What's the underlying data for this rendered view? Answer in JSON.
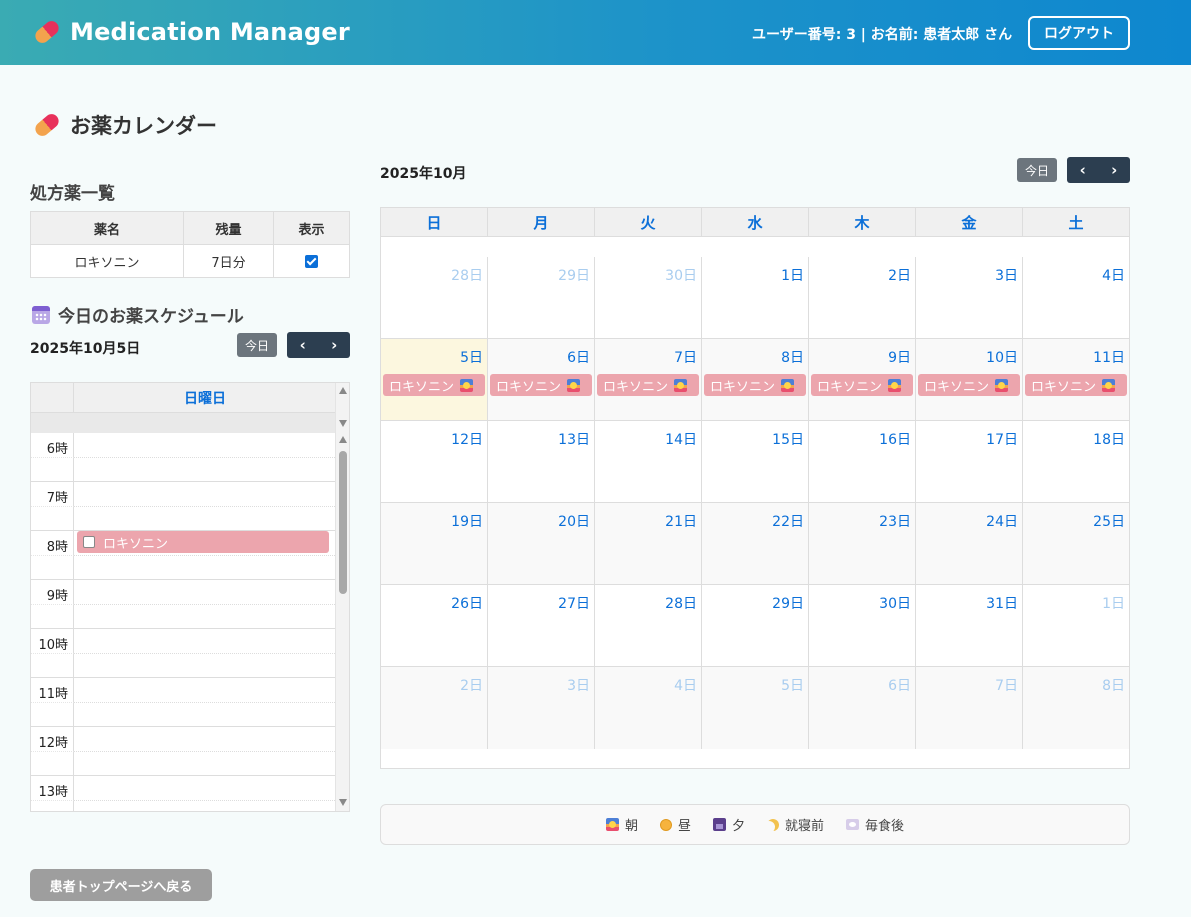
{
  "header": {
    "app_title": "Medication Manager",
    "user_info": "ユーザー番号: 3 | お名前: 患者太郎 さん",
    "logout_label": "ログアウト"
  },
  "page": {
    "title": "お薬カレンダー"
  },
  "prescriptions": {
    "heading": "処方薬一覧",
    "columns": [
      "薬名",
      "残量",
      "表示"
    ],
    "rows": [
      {
        "name": "ロキソニン",
        "remaining": "7日分",
        "shown": true
      }
    ]
  },
  "day_schedule": {
    "heading": "今日のお薬スケジュール",
    "date_label": "2025年10月5日",
    "today_label": "今日",
    "prev_icon": "chevron-left-icon",
    "next_icon": "chevron-right-icon",
    "day_of_week": "日曜日",
    "hours": [
      "6時",
      "7時",
      "8時",
      "9時",
      "10時",
      "11時",
      "12時",
      "13時"
    ],
    "event": {
      "hour": "8時",
      "label": "ロキソニン"
    }
  },
  "month_calendar": {
    "month_label": "2025年10月",
    "today_label": "今日",
    "weekdays": [
      "日",
      "月",
      "火",
      "水",
      "木",
      "金",
      "土"
    ],
    "weeks": [
      [
        {
          "d": "28日",
          "o": true
        },
        {
          "d": "29日",
          "o": true
        },
        {
          "d": "30日",
          "o": true
        },
        {
          "d": "1日"
        },
        {
          "d": "2日"
        },
        {
          "d": "3日"
        },
        {
          "d": "4日"
        }
      ],
      [
        {
          "d": "5日",
          "t": true,
          "e": "ロキソニン"
        },
        {
          "d": "6日",
          "e": "ロキソニン"
        },
        {
          "d": "7日",
          "e": "ロキソニン"
        },
        {
          "d": "8日",
          "e": "ロキソニン"
        },
        {
          "d": "9日",
          "e": "ロキソニン"
        },
        {
          "d": "10日",
          "e": "ロキソニン"
        },
        {
          "d": "11日",
          "e": "ロキソニン"
        }
      ],
      [
        {
          "d": "12日"
        },
        {
          "d": "13日"
        },
        {
          "d": "14日"
        },
        {
          "d": "15日"
        },
        {
          "d": "16日"
        },
        {
          "d": "17日"
        },
        {
          "d": "18日"
        }
      ],
      [
        {
          "d": "19日"
        },
        {
          "d": "20日"
        },
        {
          "d": "21日"
        },
        {
          "d": "22日"
        },
        {
          "d": "23日"
        },
        {
          "d": "24日"
        },
        {
          "d": "25日"
        }
      ],
      [
        {
          "d": "26日"
        },
        {
          "d": "27日"
        },
        {
          "d": "28日"
        },
        {
          "d": "29日"
        },
        {
          "d": "30日"
        },
        {
          "d": "31日"
        },
        {
          "d": "1日",
          "o": true
        }
      ],
      [
        {
          "d": "2日",
          "o": true
        },
        {
          "d": "3日",
          "o": true
        },
        {
          "d": "4日",
          "o": true
        },
        {
          "d": "5日",
          "o": true
        },
        {
          "d": "6日",
          "o": true
        },
        {
          "d": "7日",
          "o": true
        },
        {
          "d": "8日",
          "o": true
        }
      ]
    ],
    "event_icon": "sunrise-icon"
  },
  "legend": [
    {
      "icon": "sunrise-icon",
      "label": "朝"
    },
    {
      "icon": "sun-icon",
      "label": "昼"
    },
    {
      "icon": "night-icon",
      "label": "夕"
    },
    {
      "icon": "moon-icon",
      "label": "就寝前"
    },
    {
      "icon": "meal-icon",
      "label": "毎食後"
    }
  ],
  "back_button": "患者トップページへ戻る",
  "colors": {
    "accent": "#0b6fd8",
    "event_bg": "#eca5ad",
    "today_bg": "#fcf7df",
    "header_start": "#3aabb3",
    "header_end": "#0e87cf"
  }
}
